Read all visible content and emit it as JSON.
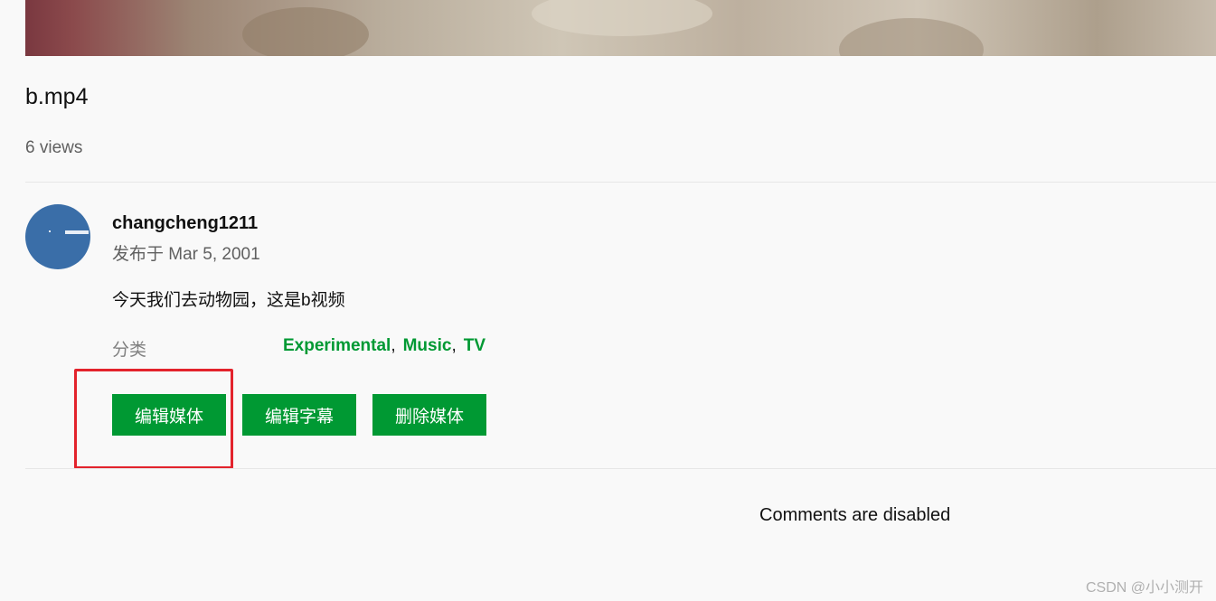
{
  "video": {
    "title": "b.mp4",
    "views": "6 views"
  },
  "uploader": {
    "name": "changcheng1211",
    "published": "发布于 Mar 5, 2001"
  },
  "description": "今天我们去动物园，这是b视频",
  "categories": {
    "label": "分类",
    "items": [
      "Experimental",
      "Music",
      "TV"
    ],
    "separator": ","
  },
  "actions": {
    "edit_media": "编辑媒体",
    "edit_subtitles": "编辑字幕",
    "delete_media": "删除媒体"
  },
  "comments": {
    "status": "Comments are disabled"
  },
  "watermark": "CSDN @小小测开",
  "colors": {
    "accent": "#009933",
    "highlight_box": "#e3232c",
    "avatar": "#3a6ea8"
  }
}
